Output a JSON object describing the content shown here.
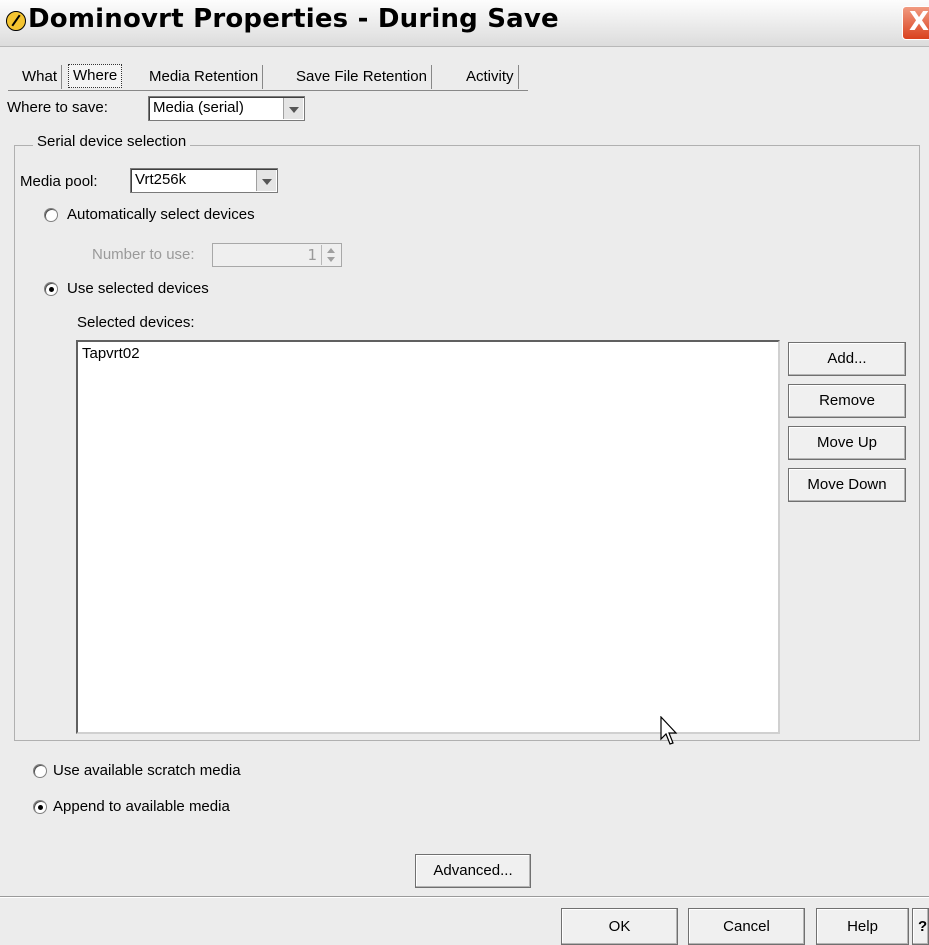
{
  "window": {
    "title": "Dominovrt Properties - During Save",
    "close_glyph": "X",
    "help_glyph": "?"
  },
  "tabs": [
    {
      "label": "What",
      "active": false
    },
    {
      "label": "Where",
      "active": true
    },
    {
      "label": "Media Retention",
      "active": false
    },
    {
      "label": "Save File Retention",
      "active": false
    },
    {
      "label": "Activity",
      "active": false
    }
  ],
  "where_to_save": {
    "label": "Where to save:",
    "value": "Media (serial)"
  },
  "serial_group": {
    "legend": "Serial device selection",
    "media_pool": {
      "label": "Media pool:",
      "value": "Vrt256k"
    },
    "auto_select": {
      "label": "Automatically select devices",
      "selected": false
    },
    "number_to_use": {
      "label": "Number to use:",
      "value": "1"
    },
    "use_selected": {
      "label": "Use selected devices",
      "selected": true
    },
    "selected_devices_label": "Selected devices:",
    "devices": [
      "Tapvrt02"
    ],
    "buttons": {
      "add": "Add...",
      "remove": "Remove",
      "move_up": "Move Up",
      "move_down": "Move Down"
    }
  },
  "media_options": {
    "scratch": {
      "label": "Use available scratch media",
      "selected": false
    },
    "append": {
      "label": "Append to available media",
      "selected": true
    }
  },
  "advanced_button": "Advanced...",
  "footer": {
    "ok": "OK",
    "cancel": "Cancel",
    "help": "Help"
  },
  "colors": {
    "dialog_bg": "#ececec",
    "close_button": "#d9411e"
  }
}
